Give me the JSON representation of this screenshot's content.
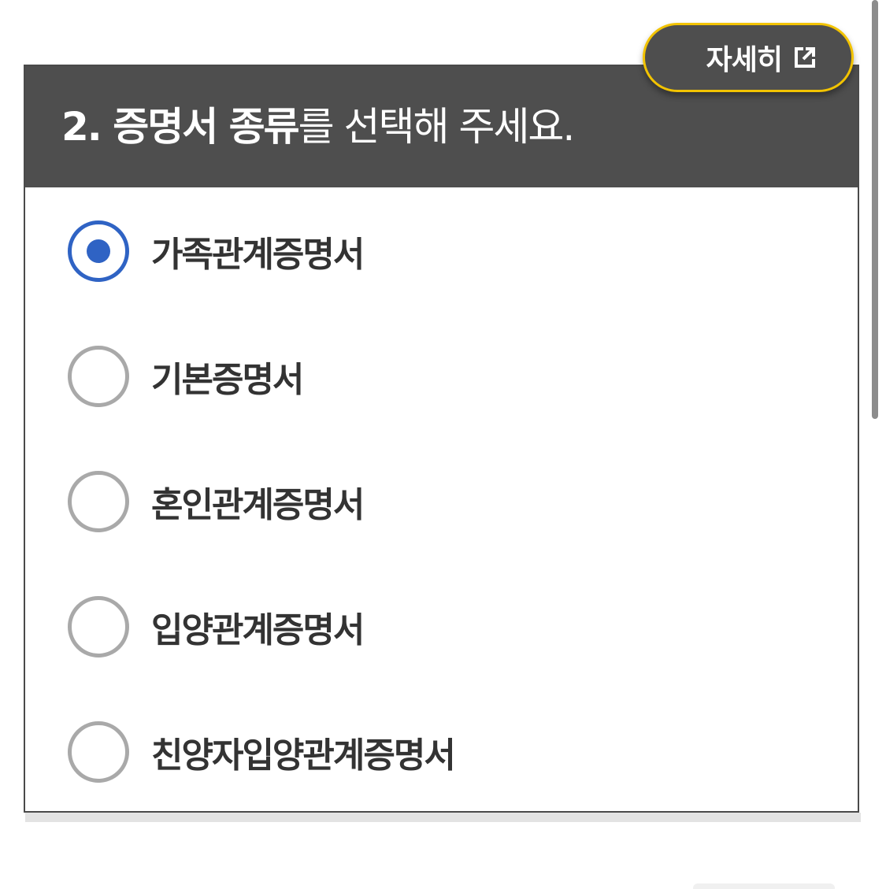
{
  "header": {
    "title_bold": "2. 증명서 종류",
    "title_rest": "를 선택해 주세요."
  },
  "detail_button": {
    "label": "자세히",
    "icon": "external-link-icon"
  },
  "options": [
    {
      "label": "가족관계증명서",
      "checked": true
    },
    {
      "label": "기본증명서",
      "checked": false
    },
    {
      "label": "혼인관계증명서",
      "checked": false
    },
    {
      "label": "입양관계증명서",
      "checked": false
    },
    {
      "label": "친양자입양관계증명서",
      "checked": false
    }
  ],
  "colors": {
    "header_bg": "#4e4e4e",
    "accent_yellow": "#f2c300",
    "radio_selected": "#2f63c4",
    "radio_unselected": "#a9a9a9"
  }
}
